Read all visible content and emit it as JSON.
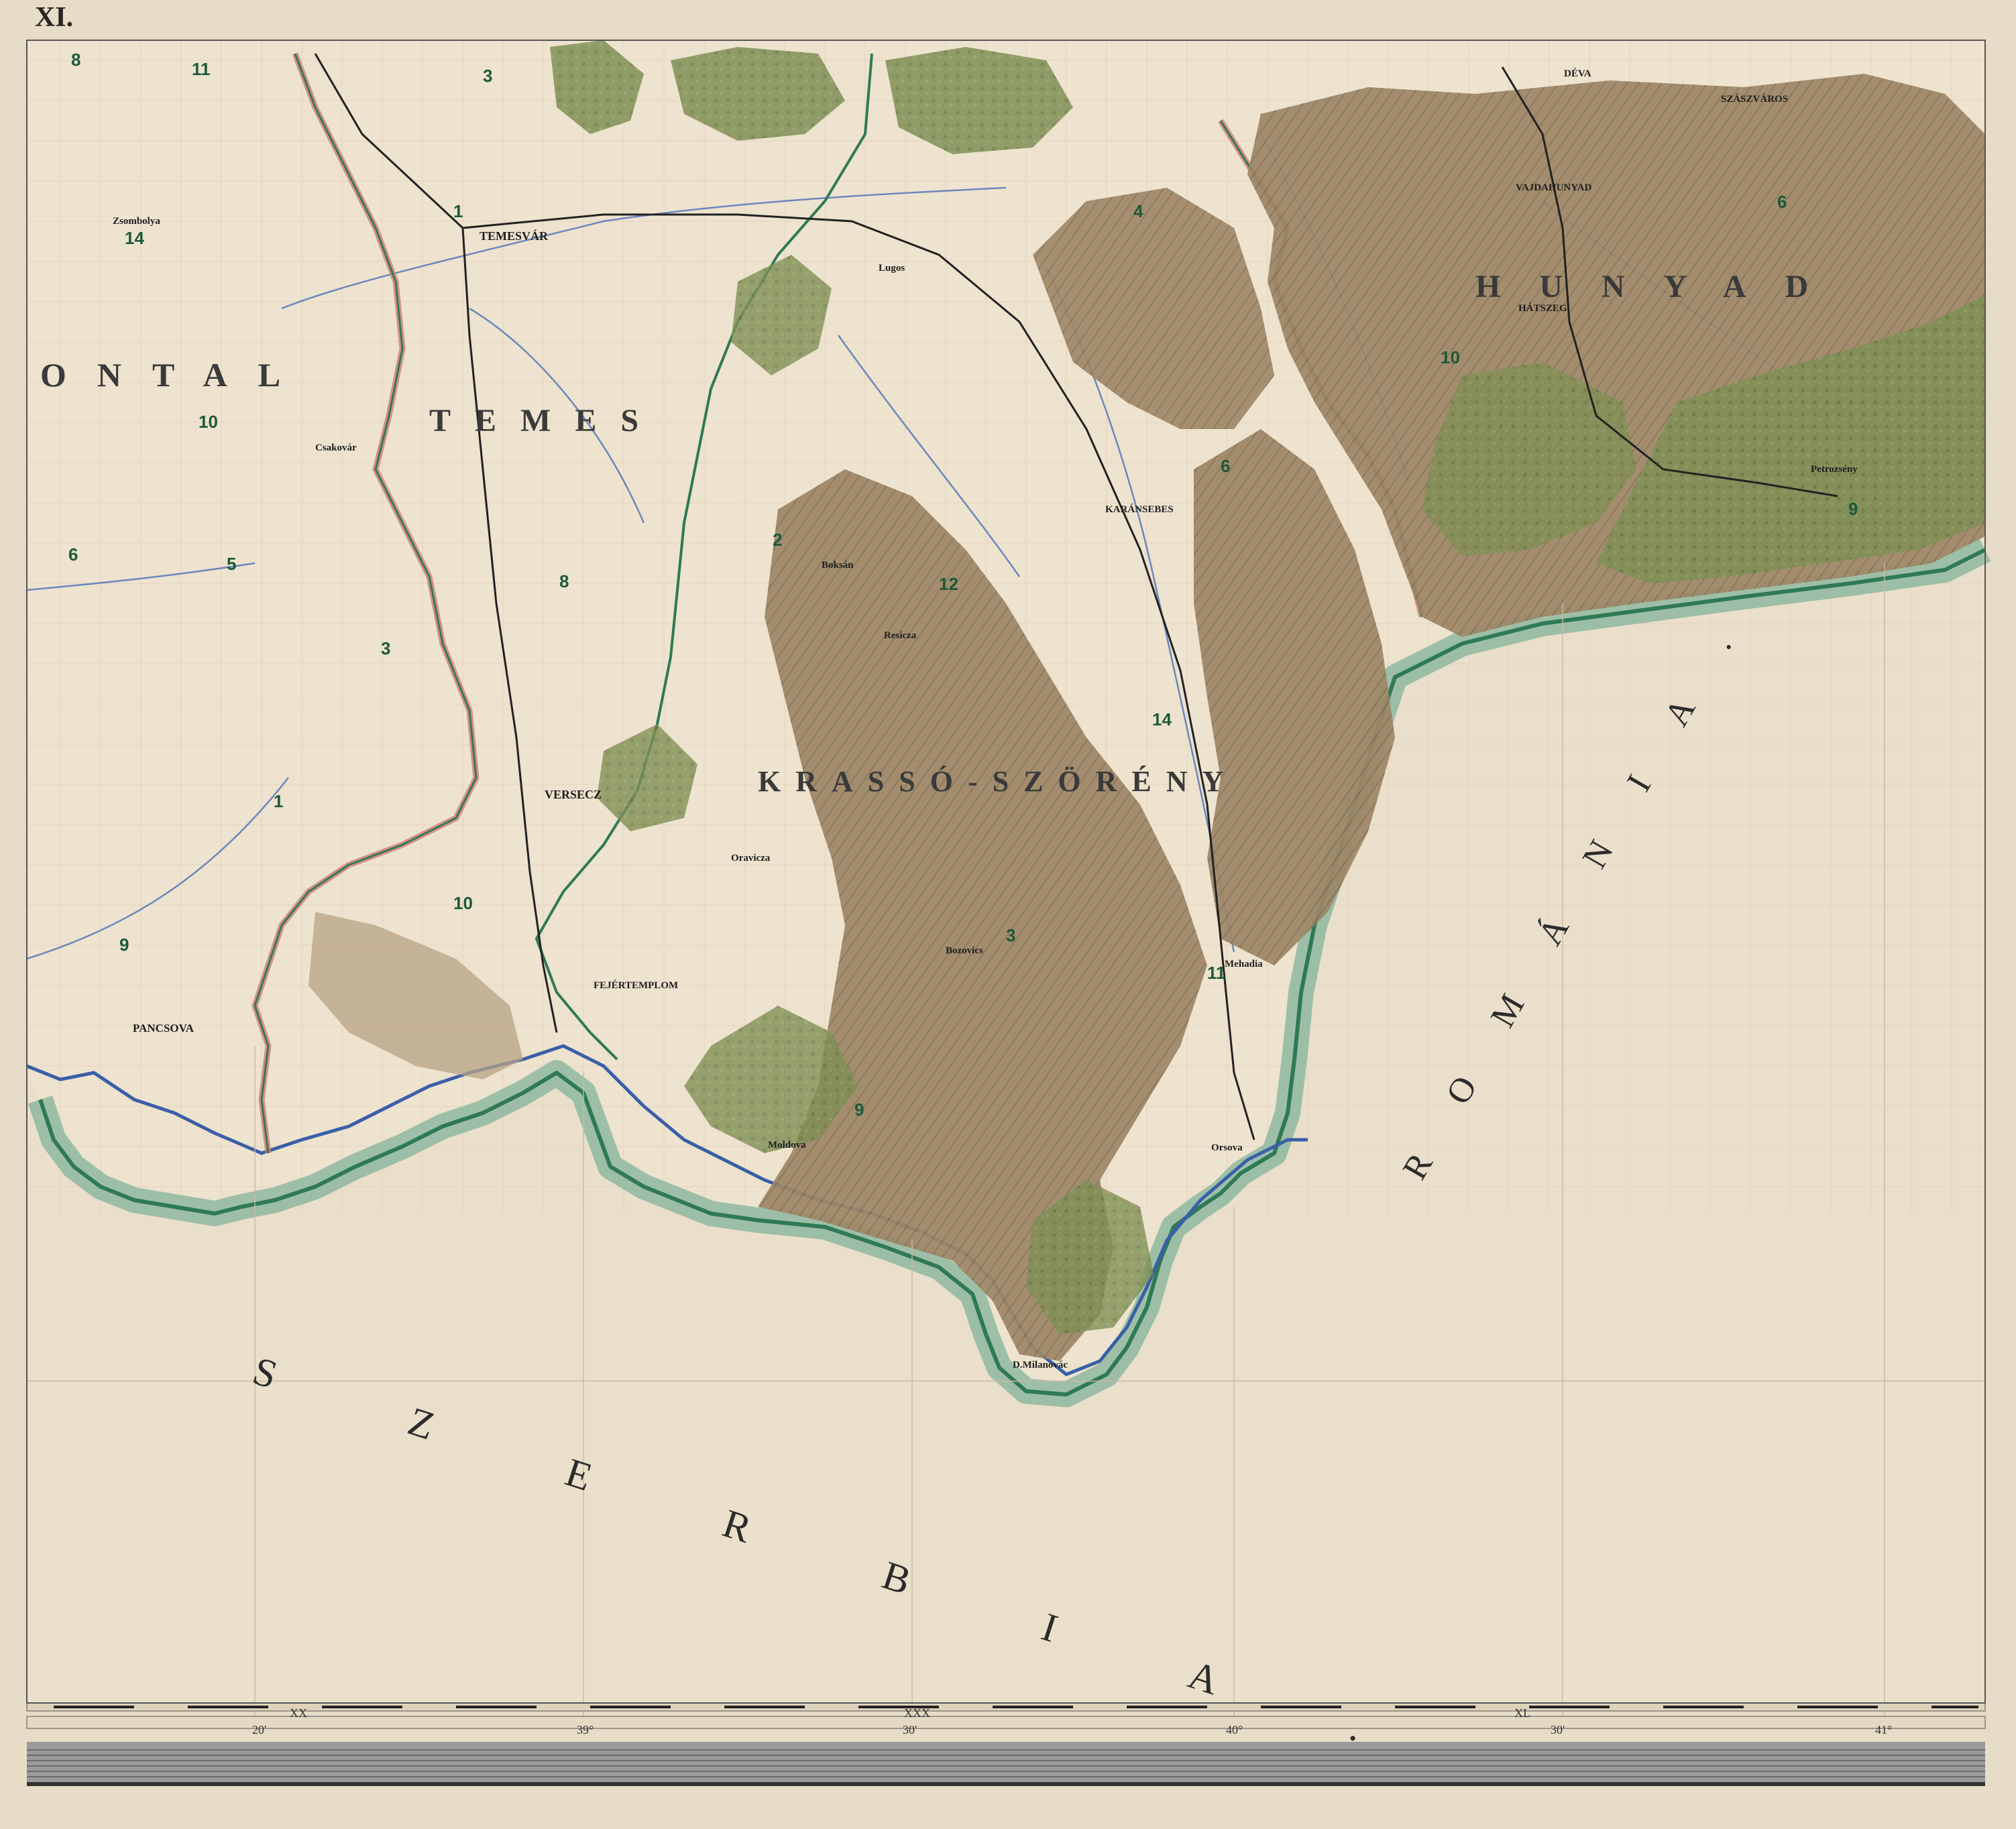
{
  "sheet": {
    "number": "XI."
  },
  "regions": {
    "serbia": "SZERBIA.",
    "romania": "ROMÁNIA."
  },
  "counties": {
    "torontal": "ONTAL",
    "temes": "TEMES",
    "krasso": "KRASSÓ-SZÖRÉNY",
    "hunyad": "HUNYAD"
  },
  "towns": {
    "temesvar": "TEMESVÁR",
    "versecz": "VERSECZ",
    "pancsova": "PANCSOVA",
    "karansebes": "KARÁNSEBES",
    "orsova": "Orsova",
    "fejertemplom": "FEJÉRTEMPLOM",
    "lugos": "Lugos",
    "deva": "DÉVA",
    "szaszvaros": "SZÁSZVÁROS",
    "vajdahunyad": "VAJDAHUNYAD",
    "hatszeg": "HÁTSZEG",
    "petroseny": "Petrozsény",
    "mehadia": "Mehadia",
    "milanovac": "D.Milanovác",
    "zsombolya": "Zsombolya",
    "csakovar": "Csakovár",
    "bogsan": "Boksán",
    "resicza": "Resicza",
    "oravicza": "Oravicza",
    "bozovics": "Bozovics",
    "moldova": "Moldova"
  },
  "scale_bar": {
    "meridians": [
      "20'",
      "39°",
      "30'",
      "40°",
      "30'",
      "41°"
    ],
    "sections": [
      "XX",
      "XXX",
      "XL"
    ]
  },
  "colors": {
    "paper": "#e7dcc7",
    "forest": "#7f8f55",
    "mountain": "#9d8666",
    "border_green": "#2f7a55",
    "border_red": "#d07a70",
    "river": "#3a5fa8",
    "coast_band": "#8fb8a0"
  }
}
